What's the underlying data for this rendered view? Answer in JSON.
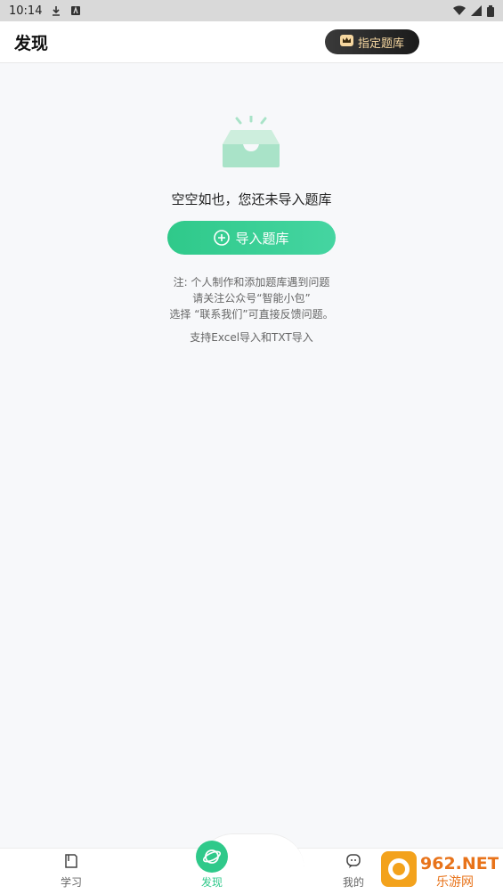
{
  "status_bar": {
    "time": "10:14",
    "icons": [
      "download-icon",
      "notification-a-icon",
      "wifi-icon",
      "signal-icon",
      "battery-icon"
    ]
  },
  "header": {
    "title": "发现",
    "vip_button_label": "指定题库",
    "vip_icon": "crown-icon"
  },
  "empty_state": {
    "icon": "empty-tray-icon",
    "message": "空空如也，您还未导入题库",
    "import_button_label": "导入题库",
    "notes": [
      "注: 个人制作和添加题库遇到问题",
      "请关注公众号“智能小包”",
      "选择 “联系我们”可直接反馈问题。"
    ],
    "support_text": "支持Excel导入和TXT导入"
  },
  "tabs": [
    {
      "label": "学习",
      "icon": "book-icon",
      "active": false
    },
    {
      "label": "发现",
      "icon": "planet-icon",
      "active": true
    },
    {
      "label": "我的",
      "icon": "chat-face-icon",
      "active": false
    }
  ],
  "watermark": {
    "text_top": "962.NET",
    "text_bottom": "乐游网"
  },
  "colors": {
    "accent": "#2fc98a",
    "vip_text": "#f6d7a0",
    "background": "#f7f8fa"
  }
}
